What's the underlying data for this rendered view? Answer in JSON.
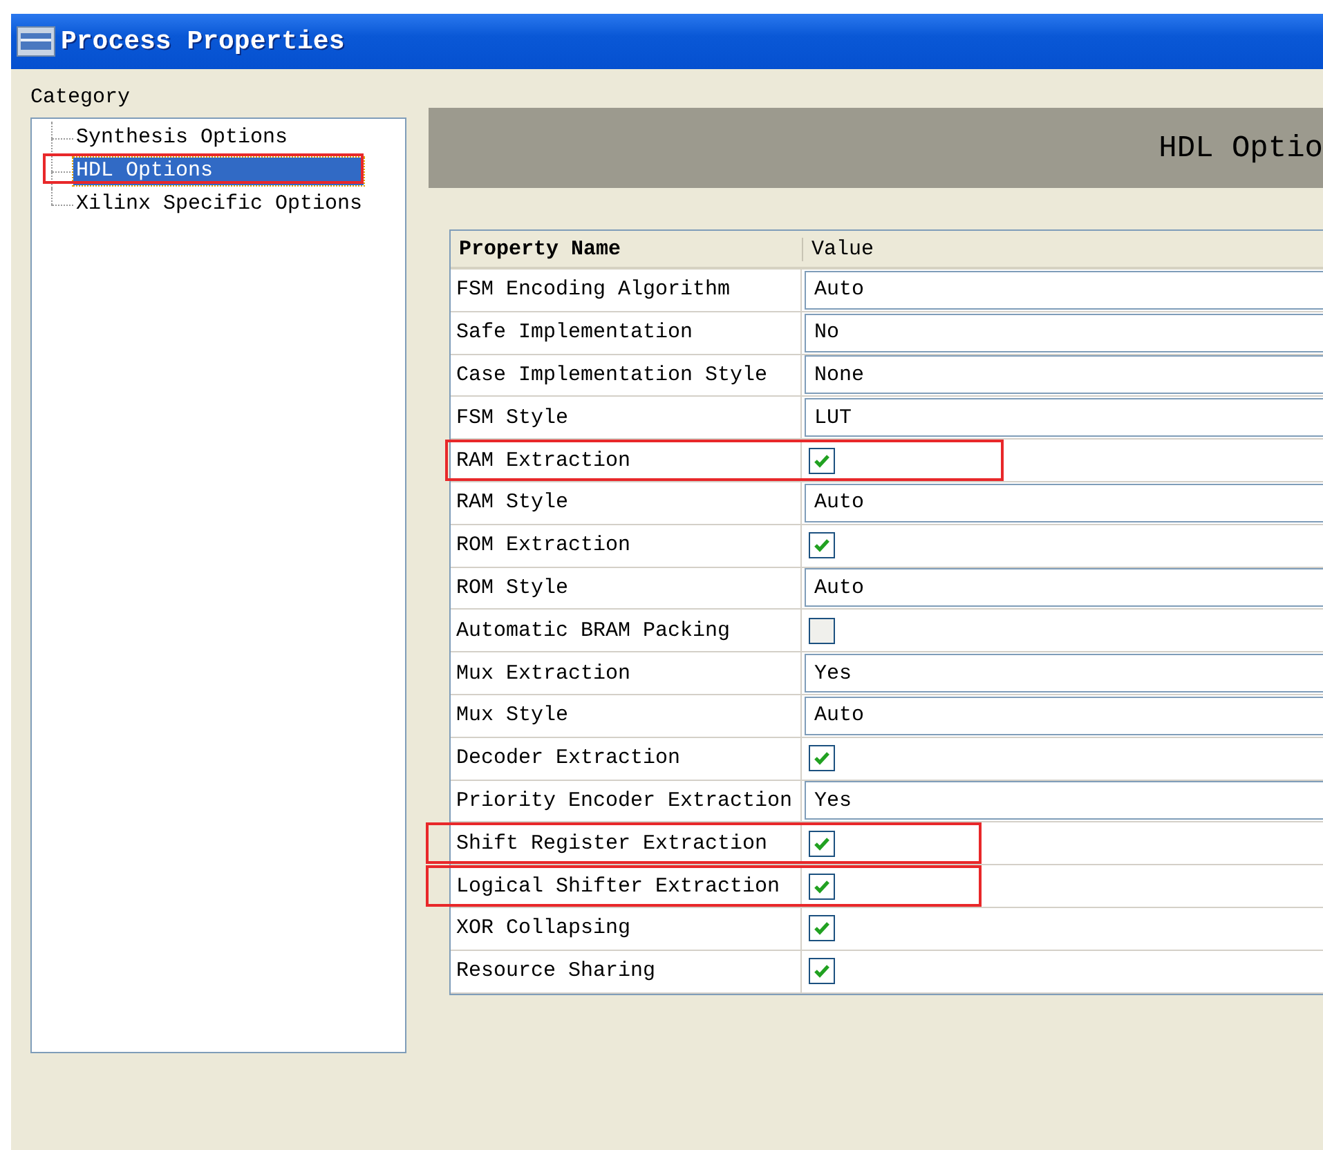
{
  "window": {
    "title": "Process Properties"
  },
  "category": {
    "label": "Category",
    "items": [
      {
        "label": "Synthesis Options",
        "selected": false,
        "highlighted": false
      },
      {
        "label": "HDL Options",
        "selected": true,
        "highlighted": true
      },
      {
        "label": "Xilinx Specific Options",
        "selected": false,
        "highlighted": false
      }
    ]
  },
  "banner": {
    "title": "HDL Optio"
  },
  "table": {
    "columns": [
      "Property Name",
      "Value"
    ],
    "rows": [
      {
        "name": "FSM Encoding Algorithm",
        "kind": "text",
        "value": "Auto",
        "highlighted": false
      },
      {
        "name": "Safe Implementation",
        "kind": "text",
        "value": "No",
        "highlighted": false
      },
      {
        "name": "Case Implementation Style",
        "kind": "text",
        "value": "None",
        "highlighted": false
      },
      {
        "name": "FSM Style",
        "kind": "text",
        "value": "LUT",
        "highlighted": false
      },
      {
        "name": "RAM Extraction",
        "kind": "checkbox",
        "checked": true,
        "highlighted": true
      },
      {
        "name": "RAM Style",
        "kind": "text",
        "value": "Auto",
        "highlighted": false
      },
      {
        "name": "ROM Extraction",
        "kind": "checkbox",
        "checked": true,
        "highlighted": false
      },
      {
        "name": "ROM Style",
        "kind": "text",
        "value": "Auto",
        "highlighted": false
      },
      {
        "name": "Automatic BRAM Packing",
        "kind": "checkbox",
        "checked": false,
        "highlighted": false
      },
      {
        "name": "Mux Extraction",
        "kind": "text",
        "value": "Yes",
        "highlighted": false
      },
      {
        "name": "Mux Style",
        "kind": "text",
        "value": "Auto",
        "highlighted": false
      },
      {
        "name": "Decoder Extraction",
        "kind": "checkbox",
        "checked": true,
        "highlighted": false
      },
      {
        "name": "Priority Encoder Extraction",
        "kind": "text",
        "value": "Yes",
        "highlighted": false
      },
      {
        "name": "Shift Register Extraction",
        "kind": "checkbox",
        "checked": true,
        "highlighted": true
      },
      {
        "name": "Logical Shifter Extraction",
        "kind": "checkbox",
        "checked": true,
        "highlighted": true
      },
      {
        "name": "XOR Collapsing",
        "kind": "checkbox",
        "checked": true,
        "highlighted": false
      },
      {
        "name": "Resource Sharing",
        "kind": "checkbox",
        "checked": true,
        "highlighted": false
      }
    ]
  }
}
